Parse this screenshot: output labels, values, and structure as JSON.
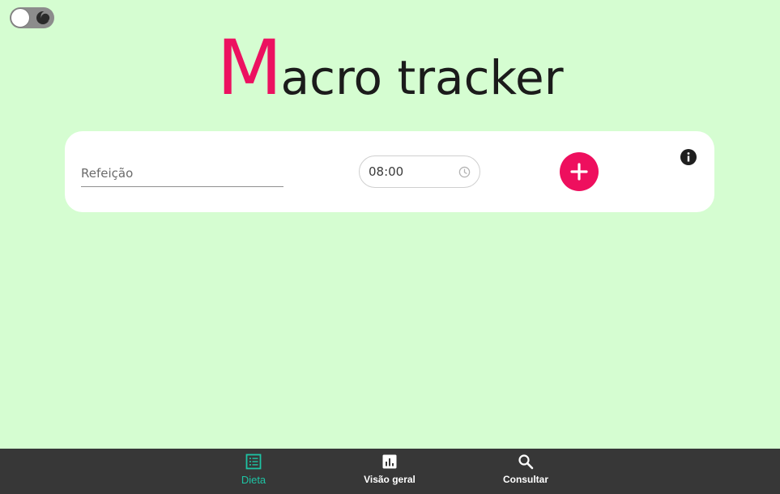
{
  "app": {
    "title_initial": "M",
    "title_rest": "acro tracker"
  },
  "theme_toggle": {
    "state": "light",
    "icon": "moon-icon"
  },
  "meal_form": {
    "meal_placeholder": "Refeição",
    "meal_value": "",
    "time_value": "08:00",
    "time_icon": "clock-icon",
    "add_icon": "plus-icon",
    "info_icon": "info-icon"
  },
  "bottom_nav": {
    "items": [
      {
        "label": "Dieta",
        "icon": "list-icon",
        "active": true
      },
      {
        "label": "Visão geral",
        "icon": "bar-chart-icon",
        "active": false
      },
      {
        "label": "Consultar",
        "icon": "search-icon",
        "active": false
      }
    ]
  },
  "colors": {
    "background": "#d5fdd1",
    "accent": "#ee0f5e",
    "nav_background": "#373737",
    "nav_active": "#1ec4a4"
  }
}
